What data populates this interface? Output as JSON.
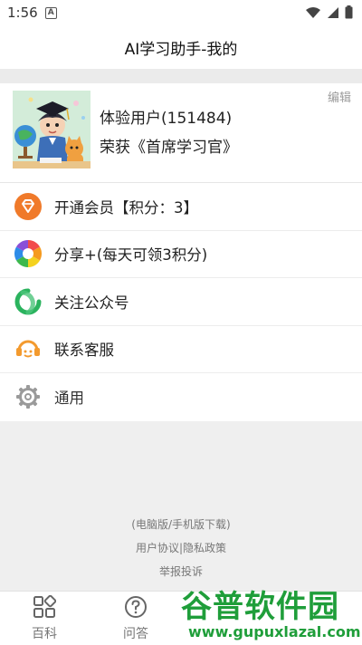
{
  "status_bar": {
    "time": "1:56",
    "notification_letter": "A"
  },
  "header": {
    "title": "AI学习助手-我的"
  },
  "profile": {
    "edit_label": "编辑",
    "user_name": "体验用户(151484)",
    "honor": "荣获《首席学习官》"
  },
  "menu": {
    "items": [
      {
        "label": "开通会员【积分：3】",
        "icon": "gem-icon",
        "color": "#f07a2a"
      },
      {
        "label": "分享+(每天可领3积分)",
        "icon": "aperture-icon",
        "color": "multi"
      },
      {
        "label": "关注公众号",
        "icon": "wechat-official-icon",
        "color": "#2bb35e"
      },
      {
        "label": "联系客服",
        "icon": "customer-service-icon",
        "color": "#f39a2e"
      },
      {
        "label": "通用",
        "icon": "gear-icon",
        "color": "#9a9a9a"
      }
    ]
  },
  "footer": {
    "download": "(电脑版/手机版下载)",
    "agreements": "用户协议|隐私政策",
    "report": "举报投诉"
  },
  "tabbar": {
    "items": [
      {
        "label": "百科",
        "icon": "grid-icon"
      },
      {
        "label": "问答",
        "icon": "question-icon"
      }
    ]
  },
  "watermark": {
    "logo_text": "谷普软件园",
    "url": "www.gupuxlazal.com"
  }
}
